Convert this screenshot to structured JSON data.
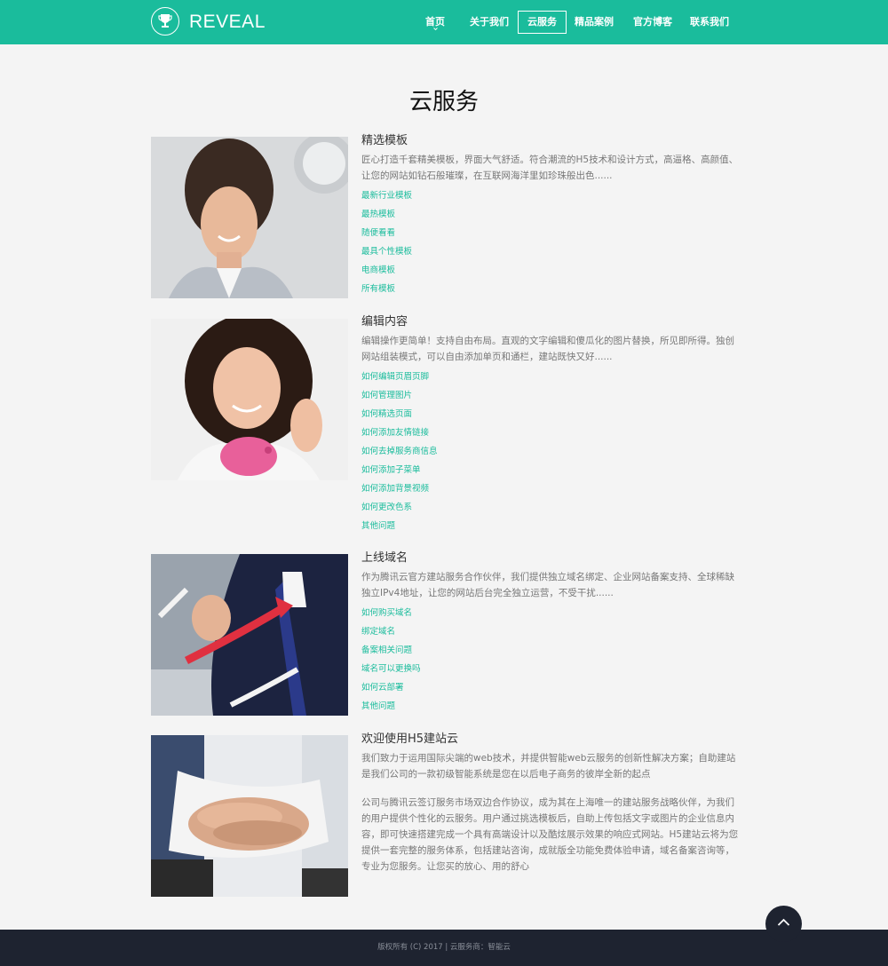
{
  "header": {
    "logo_text": "REVEAL",
    "nav": [
      {
        "label": "首页",
        "active": false
      },
      {
        "label": "关于我们",
        "active": false
      },
      {
        "label": "云服务",
        "active": true
      },
      {
        "label": "精品案例",
        "active": false
      },
      {
        "label": "官方博客",
        "active": false
      },
      {
        "label": "联系我们",
        "active": false
      }
    ]
  },
  "page": {
    "title": "云服务"
  },
  "cards": [
    {
      "title": "精选模板",
      "description": "匠心打造千套精美模板，界面大气舒适。符合潮流的H5技术和设计方式，高逼格、高颜值、让您的网站如钻石般璀璨，在互联网海洋里如珍珠般出色......",
      "links": [
        "最新行业模板",
        "最热模板",
        "随便看看",
        "最具个性模板",
        "电商模板",
        "所有模板"
      ]
    },
    {
      "title": "编辑内容",
      "description": "编辑操作更简单！支持自由布局。直观的文字编辑和傻瓜化的图片替换，所见即所得。独创网站组装模式，可以自由添加单页和通栏，建站既快又好......",
      "links": [
        "如何编辑页眉页脚",
        "如何管理图片",
        "如何精选页面",
        "如何添加友情链接",
        "如何去掉服务商信息",
        "如何添加子菜单",
        "如何添加背景视频",
        "如何更改色系",
        "其他问题"
      ]
    },
    {
      "title": "上线域名",
      "description": "作为腾讯云官方建站服务合作伙伴，我们提供独立域名绑定、企业网站备案支持、全球稀缺独立IPv4地址，让您的网站后台完全独立运营，不受干扰......",
      "links": [
        "如何购买域名",
        "绑定域名",
        "备案相关问题",
        "域名可以更换吗",
        "如何云部署",
        "其他问题"
      ]
    },
    {
      "title": "欢迎使用H5建站云",
      "description": "我们致力于运用国际尖端的web技术，并提供智能web云服务的创新性解决方案；自助建站是我们公司的一款初级智能系统是您在以后电子商务的彼岸全新的起点",
      "description2": "公司与腾讯云签订服务市场双边合作协议，成为其在上海唯一的建站服务战略伙伴，为我们的用户提供个性化的云服务。用户通过挑选模板后，自助上传包括文字或图片的企业信息内容，即可快速搭建完成一个具有高端设计以及酷炫展示效果的响应式网站。H5建站云将为您提供一套完整的服务体系，包括建站咨询，成就版全功能免费体验申请，域名备案咨询等，专业为您服务。让您买的放心、用的舒心",
      "links": []
    }
  ],
  "footer": {
    "text": "版权所有 (C) 2017 | 云服务商：智能云"
  },
  "colors": {
    "accent": "#1abc9c",
    "footer_bg": "#1e2330",
    "page_bg": "#f4f4f4"
  },
  "icons": {
    "logo": "trophy-icon",
    "scroll_top": "chevron-up-icon",
    "nav_active_marker": "chevron-down-icon"
  }
}
